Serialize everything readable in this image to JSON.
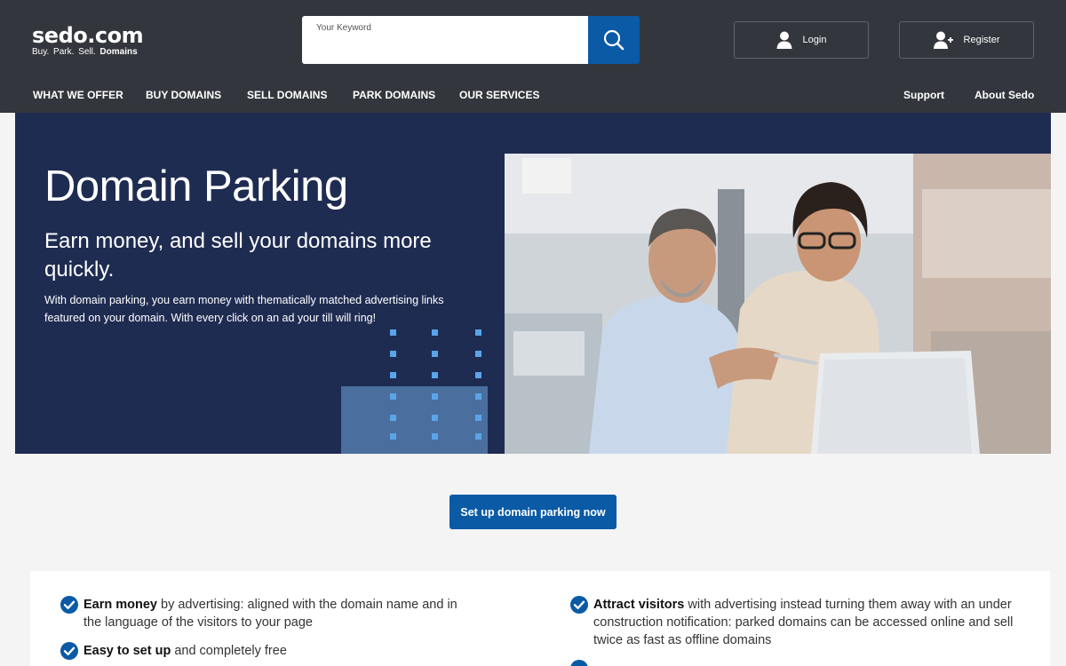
{
  "logo": {
    "main": "sedo.com",
    "tag_plain": "Buy.  Park.  Sell.",
    "tag_bold": "Domains"
  },
  "search": {
    "label": "Your Keyword",
    "placeholder": "",
    "value": ""
  },
  "header_buttons": {
    "login": "Login",
    "register": "Register"
  },
  "nav": {
    "items": [
      "WHAT WE OFFER",
      "BUY DOMAINS",
      "SELL DOMAINS",
      "PARK DOMAINS",
      "OUR SERVICES"
    ],
    "right_items": [
      "Support",
      "About Sedo"
    ]
  },
  "hero": {
    "title": "Domain Parking",
    "subtitle": "Earn money, and sell your domains more quickly.",
    "description": "With domain parking, you earn money with thematically matched advertising links featured on your domain. With every click on an ad your till will ring!"
  },
  "cta": {
    "label": "Set up domain parking now"
  },
  "features": {
    "left": [
      {
        "bold": "Earn money",
        "text": " by advertising: aligned with the domain name and in the language of the visitors to your page"
      },
      {
        "bold": "Easy to set up",
        "text": " and completely free"
      }
    ],
    "right": [
      {
        "bold": "Attract visitors",
        "text": " with advertising instead turning them away with an under construction notification: parked domains can be accessed online and sell twice as fast as offline domains"
      }
    ]
  },
  "colors": {
    "header_bg": "#33373d",
    "hero_bg": "#1f2c52",
    "accent": "#0a5aa6",
    "check": "#0a5aa6"
  },
  "icons": {
    "search": "search-icon",
    "login": "user-icon",
    "register": "user-plus-icon",
    "check": "check-circle-icon"
  }
}
